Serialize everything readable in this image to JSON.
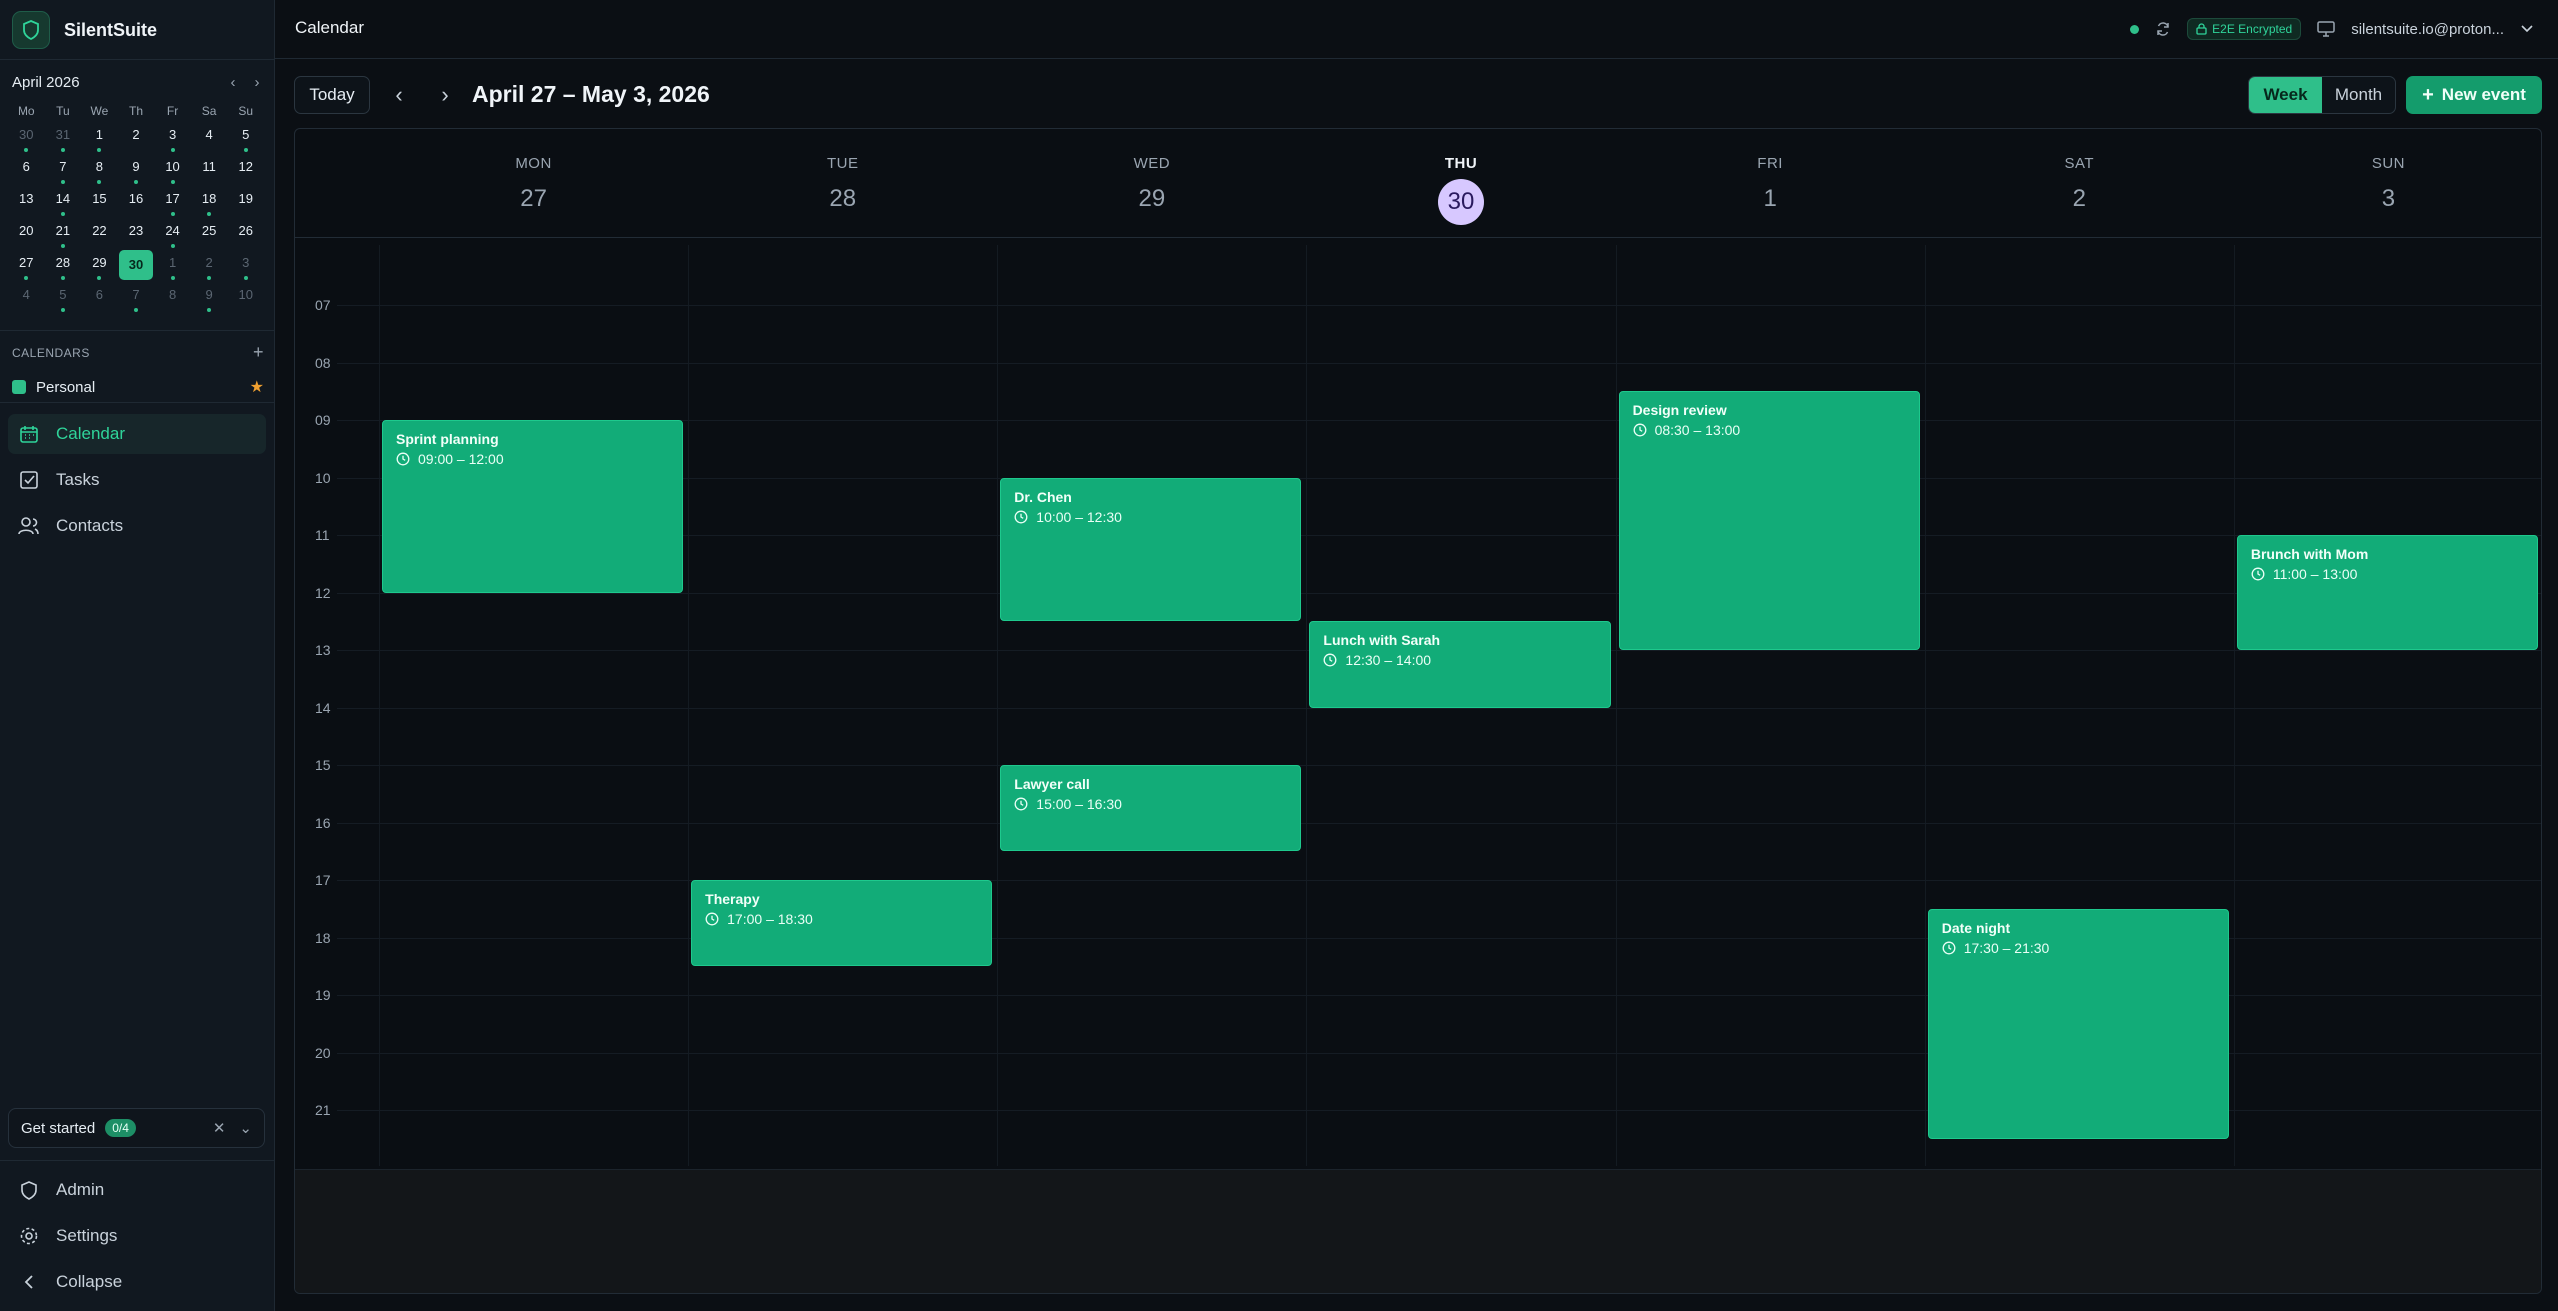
{
  "app": {
    "name": "SilentSuite"
  },
  "mini_calendar": {
    "title": "April 2026",
    "dow": [
      "Mo",
      "Tu",
      "We",
      "Th",
      "Fr",
      "Sa",
      "Su"
    ],
    "weeks": [
      [
        {
          "d": "30",
          "m": true,
          "dot": true
        },
        {
          "d": "31",
          "m": true,
          "dot": true
        },
        {
          "d": "1",
          "dot": true
        },
        {
          "d": "2"
        },
        {
          "d": "3",
          "dot": true
        },
        {
          "d": "4"
        },
        {
          "d": "5",
          "dot": true
        }
      ],
      [
        {
          "d": "6"
        },
        {
          "d": "7",
          "dot": true
        },
        {
          "d": "8",
          "dot": true
        },
        {
          "d": "9",
          "dot": true
        },
        {
          "d": "10",
          "dot": true
        },
        {
          "d": "11"
        },
        {
          "d": "12"
        }
      ],
      [
        {
          "d": "13"
        },
        {
          "d": "14",
          "dot": true
        },
        {
          "d": "15"
        },
        {
          "d": "16"
        },
        {
          "d": "17",
          "dot": true
        },
        {
          "d": "18",
          "dot": true
        },
        {
          "d": "19"
        }
      ],
      [
        {
          "d": "20"
        },
        {
          "d": "21",
          "dot": true
        },
        {
          "d": "22"
        },
        {
          "d": "23"
        },
        {
          "d": "24",
          "dot": true
        },
        {
          "d": "25"
        },
        {
          "d": "26"
        }
      ],
      [
        {
          "d": "27",
          "dot": true
        },
        {
          "d": "28",
          "dot": true
        },
        {
          "d": "29",
          "dot": true
        },
        {
          "d": "30",
          "sel": true
        },
        {
          "d": "1",
          "m": true,
          "dot": true
        },
        {
          "d": "2",
          "m": true,
          "dot": true
        },
        {
          "d": "3",
          "m": true,
          "dot": true
        }
      ],
      [
        {
          "d": "4",
          "m": true
        },
        {
          "d": "5",
          "m": true,
          "dot": true
        },
        {
          "d": "6",
          "m": true
        },
        {
          "d": "7",
          "m": true,
          "dot": true
        },
        {
          "d": "8",
          "m": true
        },
        {
          "d": "9",
          "m": true,
          "dot": true
        },
        {
          "d": "10",
          "m": true
        }
      ]
    ]
  },
  "calendars": {
    "heading": "CALENDARS",
    "items": [
      {
        "label": "Personal",
        "color": "#2fbf8a"
      }
    ]
  },
  "nav": [
    {
      "label": "Calendar",
      "icon": "calendar-icon",
      "active": true
    },
    {
      "label": "Tasks",
      "icon": "tasks-icon"
    },
    {
      "label": "Contacts",
      "icon": "contacts-icon"
    }
  ],
  "get_started": {
    "label": "Get started",
    "badge": "0/4"
  },
  "bottom_nav": [
    {
      "label": "Admin",
      "icon": "shield-icon"
    },
    {
      "label": "Settings",
      "icon": "gear-icon"
    },
    {
      "label": "Collapse",
      "icon": "chevron-left-icon"
    }
  ],
  "topbar": {
    "title": "Calendar",
    "encryption_badge": "E2E Encrypted",
    "account": "silentsuite.io@proton..."
  },
  "toolbar": {
    "today": "Today",
    "range": "April 27 – May 3, 2026",
    "week": "Week",
    "month": "Month",
    "new_event": "New event"
  },
  "week": {
    "days": [
      {
        "dow": "MON",
        "num": "27"
      },
      {
        "dow": "TUE",
        "num": "28"
      },
      {
        "dow": "WED",
        "num": "29"
      },
      {
        "dow": "THU",
        "num": "30",
        "today": true
      },
      {
        "dow": "FRI",
        "num": "1"
      },
      {
        "dow": "SAT",
        "num": "2"
      },
      {
        "dow": "SUN",
        "num": "3"
      }
    ],
    "hours": [
      "07",
      "08",
      "09",
      "10",
      "11",
      "12",
      "13",
      "14",
      "15",
      "16",
      "17",
      "18",
      "19",
      "20",
      "21"
    ]
  },
  "events": [
    {
      "title": "Sprint planning",
      "time": "09:00 – 12:00",
      "day": 0,
      "start": 9.0,
      "end": 12.0
    },
    {
      "title": "Therapy",
      "time": "17:00 – 18:30",
      "day": 1,
      "start": 17.0,
      "end": 18.5
    },
    {
      "title": "Dr. Chen",
      "time": "10:00 – 12:30",
      "day": 2,
      "start": 10.0,
      "end": 12.5
    },
    {
      "title": "Lawyer call",
      "time": "15:00 – 16:30",
      "day": 2,
      "start": 15.0,
      "end": 16.5
    },
    {
      "title": "Lunch with Sarah",
      "time": "12:30 – 14:00",
      "day": 3,
      "start": 12.5,
      "end": 14.0
    },
    {
      "title": "Design review",
      "time": "08:30 – 13:00",
      "day": 4,
      "start": 8.5,
      "end": 13.0
    },
    {
      "title": "Date night",
      "time": "17:30 – 21:30",
      "day": 5,
      "start": 17.5,
      "end": 21.5
    },
    {
      "title": "Brunch with Mom",
      "time": "11:00 – 13:00",
      "day": 6,
      "start": 11.0,
      "end": 13.0
    }
  ],
  "colors": {
    "accent": "#2fbf8a",
    "event": "#12ac78",
    "today_circle": "#d7c8ff"
  }
}
